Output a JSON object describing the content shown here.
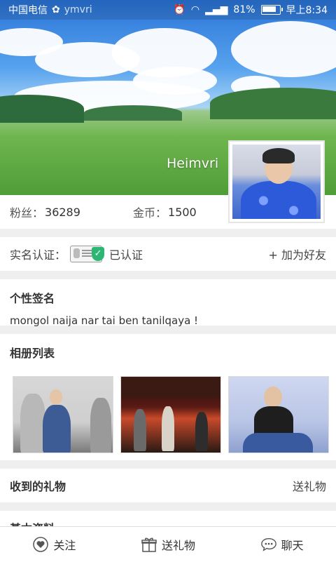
{
  "status_bar": {
    "carrier": "中国电信",
    "carrier_suffix": "ymvri",
    "battery_percent": "81%",
    "time": "早上8:34"
  },
  "profile": {
    "name": "Heimvri",
    "fans_label": "粉丝：",
    "fans_value": "36289",
    "coins_label": "金币：",
    "coins_value": "1500"
  },
  "verify": {
    "label": "实名认证：",
    "status": "已认证",
    "add_friend": "+ 加为好友"
  },
  "signature": {
    "title": "个性签名",
    "text": "mongol naija nar tai ben tanilqaya !"
  },
  "album": {
    "title": "相册列表"
  },
  "gifts": {
    "title": "收到的礼物",
    "send_link": "送礼物"
  },
  "basic_info": {
    "title": "基本资料"
  },
  "bottom_bar": {
    "follow": "关注",
    "send_gift": "送礼物",
    "chat": "聊天"
  },
  "colors": {
    "verified_green": "#2bb673",
    "background": "#efefef"
  }
}
